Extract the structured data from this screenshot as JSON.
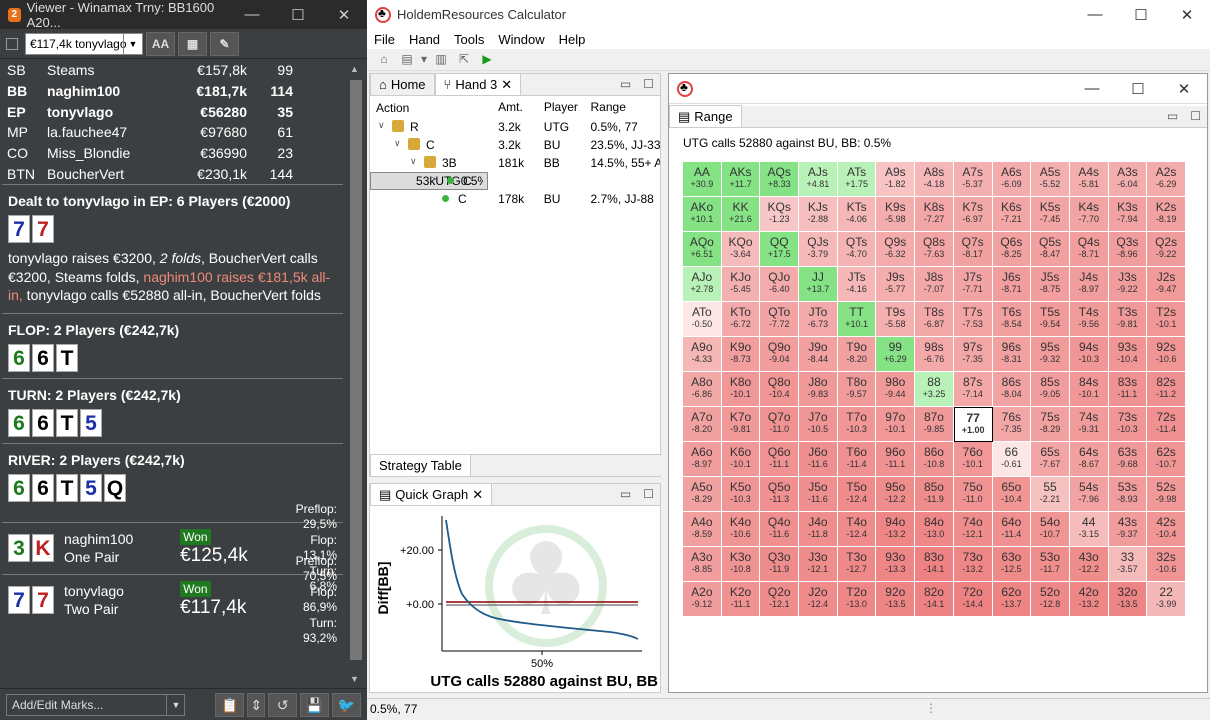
{
  "viewer": {
    "title": "Viewer - Winamax Trny: BB1600 A20...",
    "app_badge": "2",
    "player_select": "€117,4k tonyvlago",
    "font_btn": "AA",
    "players": [
      {
        "pos": "SB",
        "name": "Steams",
        "stack": "€157,8k",
        "bb": "99",
        "bold": false
      },
      {
        "pos": "BB",
        "name": "naghim100",
        "stack": "€181,7k",
        "bb": "114",
        "bold": true
      },
      {
        "pos": "EP",
        "name": "tonyvlago",
        "stack": "€56280",
        "bb": "35",
        "bold": true
      },
      {
        "pos": "MP",
        "name": "la.fauchee47",
        "stack": "€97680",
        "bb": "61",
        "bold": false
      },
      {
        "pos": "CO",
        "name": "Miss_Blondie",
        "stack": "€36990",
        "bb": "23",
        "bold": false
      },
      {
        "pos": "BTN",
        "name": "BoucherVert",
        "stack": "€230,1k",
        "bb": "144",
        "bold": false
      }
    ],
    "dealt_head": "Dealt to tonyvlago in EP: 6 Players (€2000)",
    "dealt_cards": [
      {
        "r": "7",
        "c": "blue"
      },
      {
        "r": "7",
        "c": "red"
      }
    ],
    "action_1": "tonyvlago raises €3200, ",
    "action_2": "2 folds",
    "action_3": ", BoucherVert calls €3200, Steams folds, ",
    "action_4": "naghim100 raises €181,5k all-in,",
    "action_5": " tonyvlago calls €52880 all-in, BoucherVert folds",
    "flop_head": "FLOP: 2 Players (€242,7k)",
    "flop_cards": [
      {
        "r": "6",
        "c": "green"
      },
      {
        "r": "6",
        "c": "blk"
      },
      {
        "r": "T",
        "c": "blk"
      }
    ],
    "turn_head": "TURN: 2 Players (€242,7k)",
    "turn_cards": [
      {
        "r": "6",
        "c": "green"
      },
      {
        "r": "6",
        "c": "blk"
      },
      {
        "r": "T",
        "c": "blk"
      },
      {
        "r": "5",
        "c": "blue"
      }
    ],
    "river_head": "RIVER: 2 Players (€242,7k)",
    "river_cards": [
      {
        "r": "6",
        "c": "green"
      },
      {
        "r": "6",
        "c": "blk"
      },
      {
        "r": "T",
        "c": "blk"
      },
      {
        "r": "5",
        "c": "blue"
      },
      {
        "r": "Q",
        "c": "blk"
      }
    ],
    "results": [
      {
        "cards": [
          {
            "r": "3",
            "c": "green"
          },
          {
            "r": "K",
            "c": "red"
          }
        ],
        "name": "naghim100",
        "hand": "One Pair",
        "won": "Won",
        "amount": "€125,4k",
        "pre_l": "Preflop:",
        "pre": "29,5%",
        "flop_l": "Flop:",
        "flop": "13,1%",
        "turn_l": "Turn:",
        "turn": "6,8%"
      },
      {
        "cards": [
          {
            "r": "7",
            "c": "blue"
          },
          {
            "r": "7",
            "c": "red"
          }
        ],
        "name": "tonyvlago",
        "hand": "Two Pair",
        "won": "Won",
        "amount": "€117,4k",
        "pre_l": "Preflop:",
        "pre": "70,5%",
        "flop_l": "Flop:",
        "flop": "86,9%",
        "turn_l": "Turn:",
        "turn": "93,2%"
      }
    ],
    "marks_label": "Add/Edit Marks..."
  },
  "calc": {
    "title": "HoldemResources Calculator",
    "menu": [
      "File",
      "Hand",
      "Tools",
      "Window",
      "Help"
    ],
    "tabs": {
      "home": "Home",
      "hand": "Hand 3",
      "strategy": "Strategy Table",
      "quick": "Quick Graph",
      "range": "Range"
    },
    "tree_headers": [
      "Action",
      "Amt.",
      "Player",
      "Range"
    ],
    "tree": [
      {
        "lvl": 0,
        "icon": "lock",
        "label": "R",
        "amt": "3.2k",
        "player": "UTG",
        "range": "0.5%, 77",
        "sel": false
      },
      {
        "lvl": 1,
        "icon": "lock",
        "label": "C",
        "amt": "3.2k",
        "player": "BU",
        "range": "23.5%, JJ-33",
        "sel": false
      },
      {
        "lvl": 2,
        "icon": "lock",
        "label": "3B",
        "amt": "181k",
        "player": "BB",
        "range": "14.5%, 55+ A",
        "sel": false
      },
      {
        "lvl": 3,
        "icon": "dot",
        "label": "C",
        "amt": "53k",
        "player": "UTG",
        "range": "0.5%, 77",
        "sel": true
      },
      {
        "lvl": 3,
        "icon": "dot",
        "label": "C",
        "amt": "178k",
        "player": "BU",
        "range": "2.7%, JJ-88",
        "sel": false
      }
    ],
    "range_header": "UTG calls 52880 against BU, BB: 0.5%",
    "highlight": "77",
    "grid": [
      [
        "AA",
        "+30.9"
      ],
      [
        "AKs",
        "+11.7"
      ],
      [
        "AQs",
        "+8.33"
      ],
      [
        "AJs",
        "+4.81"
      ],
      [
        "ATs",
        "+1.75"
      ],
      [
        "A9s",
        "-1.82"
      ],
      [
        "A8s",
        "-4.18"
      ],
      [
        "A7s",
        "-5.37"
      ],
      [
        "A6s",
        "-6.09"
      ],
      [
        "A5s",
        "-5.52"
      ],
      [
        "A4s",
        "-5.81"
      ],
      [
        "A3s",
        "-6.04"
      ],
      [
        "A2s",
        "-6.29"
      ],
      [
        "AKo",
        "+10.1"
      ],
      [
        "KK",
        "+21.6"
      ],
      [
        "KQs",
        "-1.23"
      ],
      [
        "KJs",
        "-2.88"
      ],
      [
        "KTs",
        "-4.06"
      ],
      [
        "K9s",
        "-5.98"
      ],
      [
        "K8s",
        "-7.27"
      ],
      [
        "K7s",
        "-6.97"
      ],
      [
        "K6s",
        "-7.21"
      ],
      [
        "K5s",
        "-7.45"
      ],
      [
        "K4s",
        "-7.70"
      ],
      [
        "K3s",
        "-7.94"
      ],
      [
        "K2s",
        "-8.19"
      ],
      [
        "AQo",
        "+6.51"
      ],
      [
        "KQo",
        "-3.64"
      ],
      [
        "QQ",
        "+17.5"
      ],
      [
        "QJs",
        "-3.79"
      ],
      [
        "QTs",
        "-4.70"
      ],
      [
        "Q9s",
        "-6.32"
      ],
      [
        "Q8s",
        "-7.63"
      ],
      [
        "Q7s",
        "-8.17"
      ],
      [
        "Q6s",
        "-8.25"
      ],
      [
        "Q5s",
        "-8.47"
      ],
      [
        "Q4s",
        "-8.71"
      ],
      [
        "Q3s",
        "-8.96"
      ],
      [
        "Q2s",
        "-9.22"
      ],
      [
        "AJo",
        "+2.78"
      ],
      [
        "KJo",
        "-5.45"
      ],
      [
        "QJo",
        "-6.40"
      ],
      [
        "JJ",
        "+13.7"
      ],
      [
        "JTs",
        "-4.16"
      ],
      [
        "J9s",
        "-5.77"
      ],
      [
        "J8s",
        "-7.07"
      ],
      [
        "J7s",
        "-7.71"
      ],
      [
        "J6s",
        "-8.71"
      ],
      [
        "J5s",
        "-8.75"
      ],
      [
        "J4s",
        "-8.97"
      ],
      [
        "J3s",
        "-9.22"
      ],
      [
        "J2s",
        "-9.47"
      ],
      [
        "ATo",
        "-0.50"
      ],
      [
        "KTo",
        "-6.72"
      ],
      [
        "QTo",
        "-7.72"
      ],
      [
        "JTo",
        "-6.73"
      ],
      [
        "TT",
        "+10.1"
      ],
      [
        "T9s",
        "-5.58"
      ],
      [
        "T8s",
        "-6.87"
      ],
      [
        "T7s",
        "-7.53"
      ],
      [
        "T6s",
        "-8.54"
      ],
      [
        "T5s",
        "-9.54"
      ],
      [
        "T4s",
        "-9.56"
      ],
      [
        "T3s",
        "-9.81"
      ],
      [
        "T2s",
        "-10.1"
      ],
      [
        "A9o",
        "-4.33"
      ],
      [
        "K9o",
        "-8.73"
      ],
      [
        "Q9o",
        "-9.04"
      ],
      [
        "J9o",
        "-8.44"
      ],
      [
        "T9o",
        "-8.20"
      ],
      [
        "99",
        "+6.29"
      ],
      [
        "98s",
        "-6.76"
      ],
      [
        "97s",
        "-7.35"
      ],
      [
        "96s",
        "-8.31"
      ],
      [
        "95s",
        "-9.32"
      ],
      [
        "94s",
        "-10.3"
      ],
      [
        "93s",
        "-10.4"
      ],
      [
        "92s",
        "-10.6"
      ],
      [
        "A8o",
        "-6.86"
      ],
      [
        "K8o",
        "-10.1"
      ],
      [
        "Q8o",
        "-10.4"
      ],
      [
        "J8o",
        "-9.83"
      ],
      [
        "T8o",
        "-9.57"
      ],
      [
        "98o",
        "-9.44"
      ],
      [
        "88",
        "+3.25"
      ],
      [
        "87s",
        "-7.14"
      ],
      [
        "86s",
        "-8.04"
      ],
      [
        "85s",
        "-9.05"
      ],
      [
        "84s",
        "-10.1"
      ],
      [
        "83s",
        "-11.1"
      ],
      [
        "82s",
        "-11.2"
      ],
      [
        "A7o",
        "-8.20"
      ],
      [
        "K7o",
        "-9.81"
      ],
      [
        "Q7o",
        "-11.0"
      ],
      [
        "J7o",
        "-10.5"
      ],
      [
        "T7o",
        "-10.3"
      ],
      [
        "97o",
        "-10.1"
      ],
      [
        "87o",
        "-9.85"
      ],
      [
        "77",
        "+1.00"
      ],
      [
        "76s",
        "-7.35"
      ],
      [
        "75s",
        "-8.29"
      ],
      [
        "74s",
        "-9.31"
      ],
      [
        "73s",
        "-10.3"
      ],
      [
        "72s",
        "-11.4"
      ],
      [
        "A6o",
        "-8.97"
      ],
      [
        "K6o",
        "-10.1"
      ],
      [
        "Q6o",
        "-11.1"
      ],
      [
        "J6o",
        "-11.6"
      ],
      [
        "T6o",
        "-11.4"
      ],
      [
        "96o",
        "-11.1"
      ],
      [
        "86o",
        "-10.8"
      ],
      [
        "76o",
        "-10.1"
      ],
      [
        "66",
        "-0.61"
      ],
      [
        "65s",
        "-7.67"
      ],
      [
        "64s",
        "-8.67"
      ],
      [
        "63s",
        "-9.68"
      ],
      [
        "62s",
        "-10.7"
      ],
      [
        "A5o",
        "-8.29"
      ],
      [
        "K5o",
        "-10.3"
      ],
      [
        "Q5o",
        "-11.3"
      ],
      [
        "J5o",
        "-11.6"
      ],
      [
        "T5o",
        "-12.4"
      ],
      [
        "95o",
        "-12.2"
      ],
      [
        "85o",
        "-11.9"
      ],
      [
        "75o",
        "-11.0"
      ],
      [
        "65o",
        "-10.4"
      ],
      [
        "55",
        "-2.21"
      ],
      [
        "54s",
        "-7.96"
      ],
      [
        "53s",
        "-8.93"
      ],
      [
        "52s",
        "-9.98"
      ],
      [
        "A4o",
        "-8.59"
      ],
      [
        "K4o",
        "-10.6"
      ],
      [
        "Q4o",
        "-11.6"
      ],
      [
        "J4o",
        "-11.8"
      ],
      [
        "T4o",
        "-12.4"
      ],
      [
        "94o",
        "-13.2"
      ],
      [
        "84o",
        "-13.0"
      ],
      [
        "74o",
        "-12.1"
      ],
      [
        "64o",
        "-11.4"
      ],
      [
        "54o",
        "-10.7"
      ],
      [
        "44",
        "-3.15"
      ],
      [
        "43s",
        "-9.37"
      ],
      [
        "42s",
        "-10.4"
      ],
      [
        "A3o",
        "-8.85"
      ],
      [
        "K3o",
        "-10.8"
      ],
      [
        "Q3o",
        "-11.9"
      ],
      [
        "J3o",
        "-12.1"
      ],
      [
        "T3o",
        "-12.7"
      ],
      [
        "93o",
        "-13.3"
      ],
      [
        "83o",
        "-14.1"
      ],
      [
        "73o",
        "-13.2"
      ],
      [
        "63o",
        "-12.5"
      ],
      [
        "53o",
        "-11.7"
      ],
      [
        "43o",
        "-12.2"
      ],
      [
        "33",
        "-3.57"
      ],
      [
        "32s",
        "-10.6"
      ],
      [
        "A2o",
        "-9.12"
      ],
      [
        "K2o",
        "-11.1"
      ],
      [
        "Q2o",
        "-12.1"
      ],
      [
        "J2o",
        "-12.4"
      ],
      [
        "T2o",
        "-13.0"
      ],
      [
        "92o",
        "-13.5"
      ],
      [
        "82o",
        "-14.1"
      ],
      [
        "72o",
        "-14.4"
      ],
      [
        "62o",
        "-13.7"
      ],
      [
        "52o",
        "-12.8"
      ],
      [
        "42o",
        "-13.2"
      ],
      [
        "32o",
        "-13.5"
      ],
      [
        "22",
        "-3.99"
      ]
    ],
    "graph": {
      "ylabel": "Diff[BB]",
      "ytick_top": "+20.00",
      "ytick_zero": "+0.00",
      "xtick": "50%",
      "caption": "UTG calls 52880 against BU, BB"
    },
    "status": "0.5%, 77"
  }
}
